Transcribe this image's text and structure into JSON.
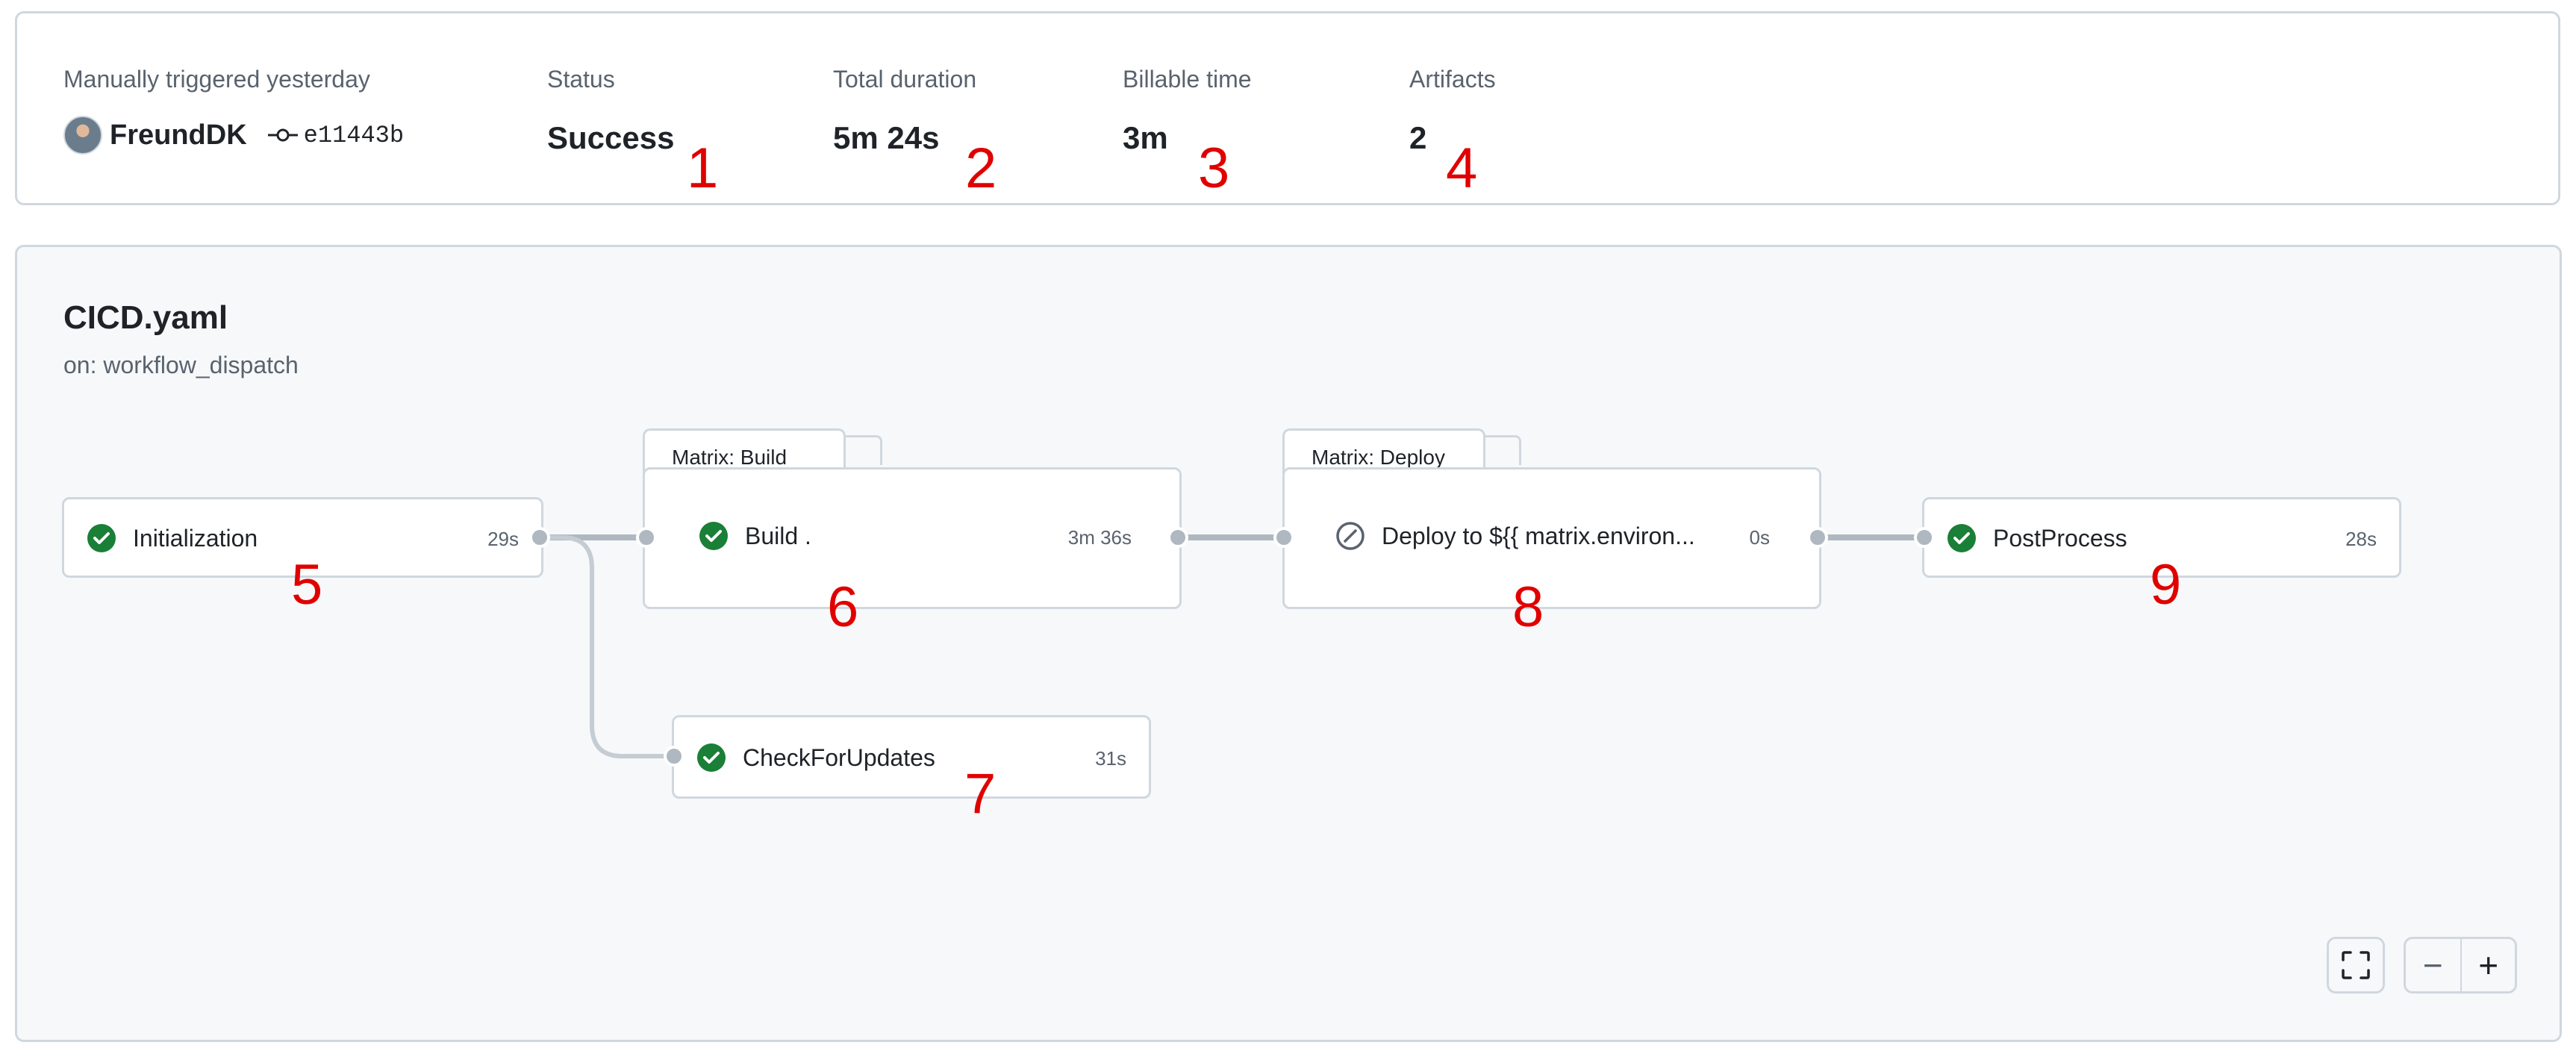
{
  "summary": {
    "trigger_label": "Manually triggered yesterday",
    "actor": "FreundDK",
    "commit": "e11443b",
    "status_label": "Status",
    "status_value": "Success",
    "duration_label": "Total duration",
    "duration_value": "5m 24s",
    "billable_label": "Billable time",
    "billable_value": "3m",
    "artifacts_label": "Artifacts",
    "artifacts_value": "2"
  },
  "workflow": {
    "name": "CICD.yaml",
    "trigger": "on: workflow_dispatch"
  },
  "jobs": {
    "initialization": {
      "name": "Initialization",
      "duration": "29s",
      "status": "success"
    },
    "build": {
      "group": "Matrix: Build",
      "name": "Build .",
      "duration": "3m 36s",
      "status": "success"
    },
    "check": {
      "name": "CheckForUpdates",
      "duration": "31s",
      "status": "success"
    },
    "deploy": {
      "group": "Matrix: Deploy",
      "name": "Deploy to ${{ matrix.environ...",
      "duration": "0s",
      "status": "skipped"
    },
    "post": {
      "name": "PostProcess",
      "duration": "28s",
      "status": "success"
    }
  },
  "controls": {
    "fullscreen_icon": "fullscreen-icon",
    "zoom_out_label": "−",
    "zoom_in_label": "+"
  },
  "markers": [
    "1",
    "2",
    "3",
    "4",
    "5",
    "6",
    "7",
    "8",
    "9"
  ],
  "colors": {
    "success": "#1a7f37",
    "marker": "#e00000",
    "border": "#d0d7de",
    "muted": "#59636e"
  }
}
